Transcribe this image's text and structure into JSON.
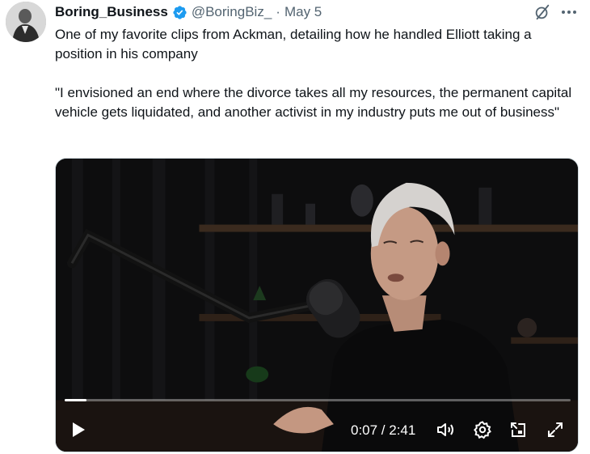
{
  "tweet": {
    "author_name": "Boring_Business",
    "handle": "@BoringBiz_",
    "separator": "·",
    "date": "May 5",
    "text_line1": "One of my favorite clips from Ackman, detailing how he handled Elliott taking a position in his company",
    "text_quote": "\"I envisioned an end where the divorce takes all my resources, the permanent capital vehicle gets liquidated, and another activist in my industry puts me out of business\""
  },
  "video": {
    "time_display": "0:07 / 2:41",
    "progress": 0.0435
  },
  "colors": {
    "verified_blue": "#1d9bf0",
    "handle_gray": "#536471"
  },
  "icons": {
    "verified": "verified-badge-icon",
    "grok": "grok-icon",
    "more": "more-icon",
    "play": "play-icon",
    "volume": "volume-icon",
    "settings": "gear-icon",
    "pip": "picture-in-picture-icon",
    "fullscreen": "fullscreen-icon"
  }
}
